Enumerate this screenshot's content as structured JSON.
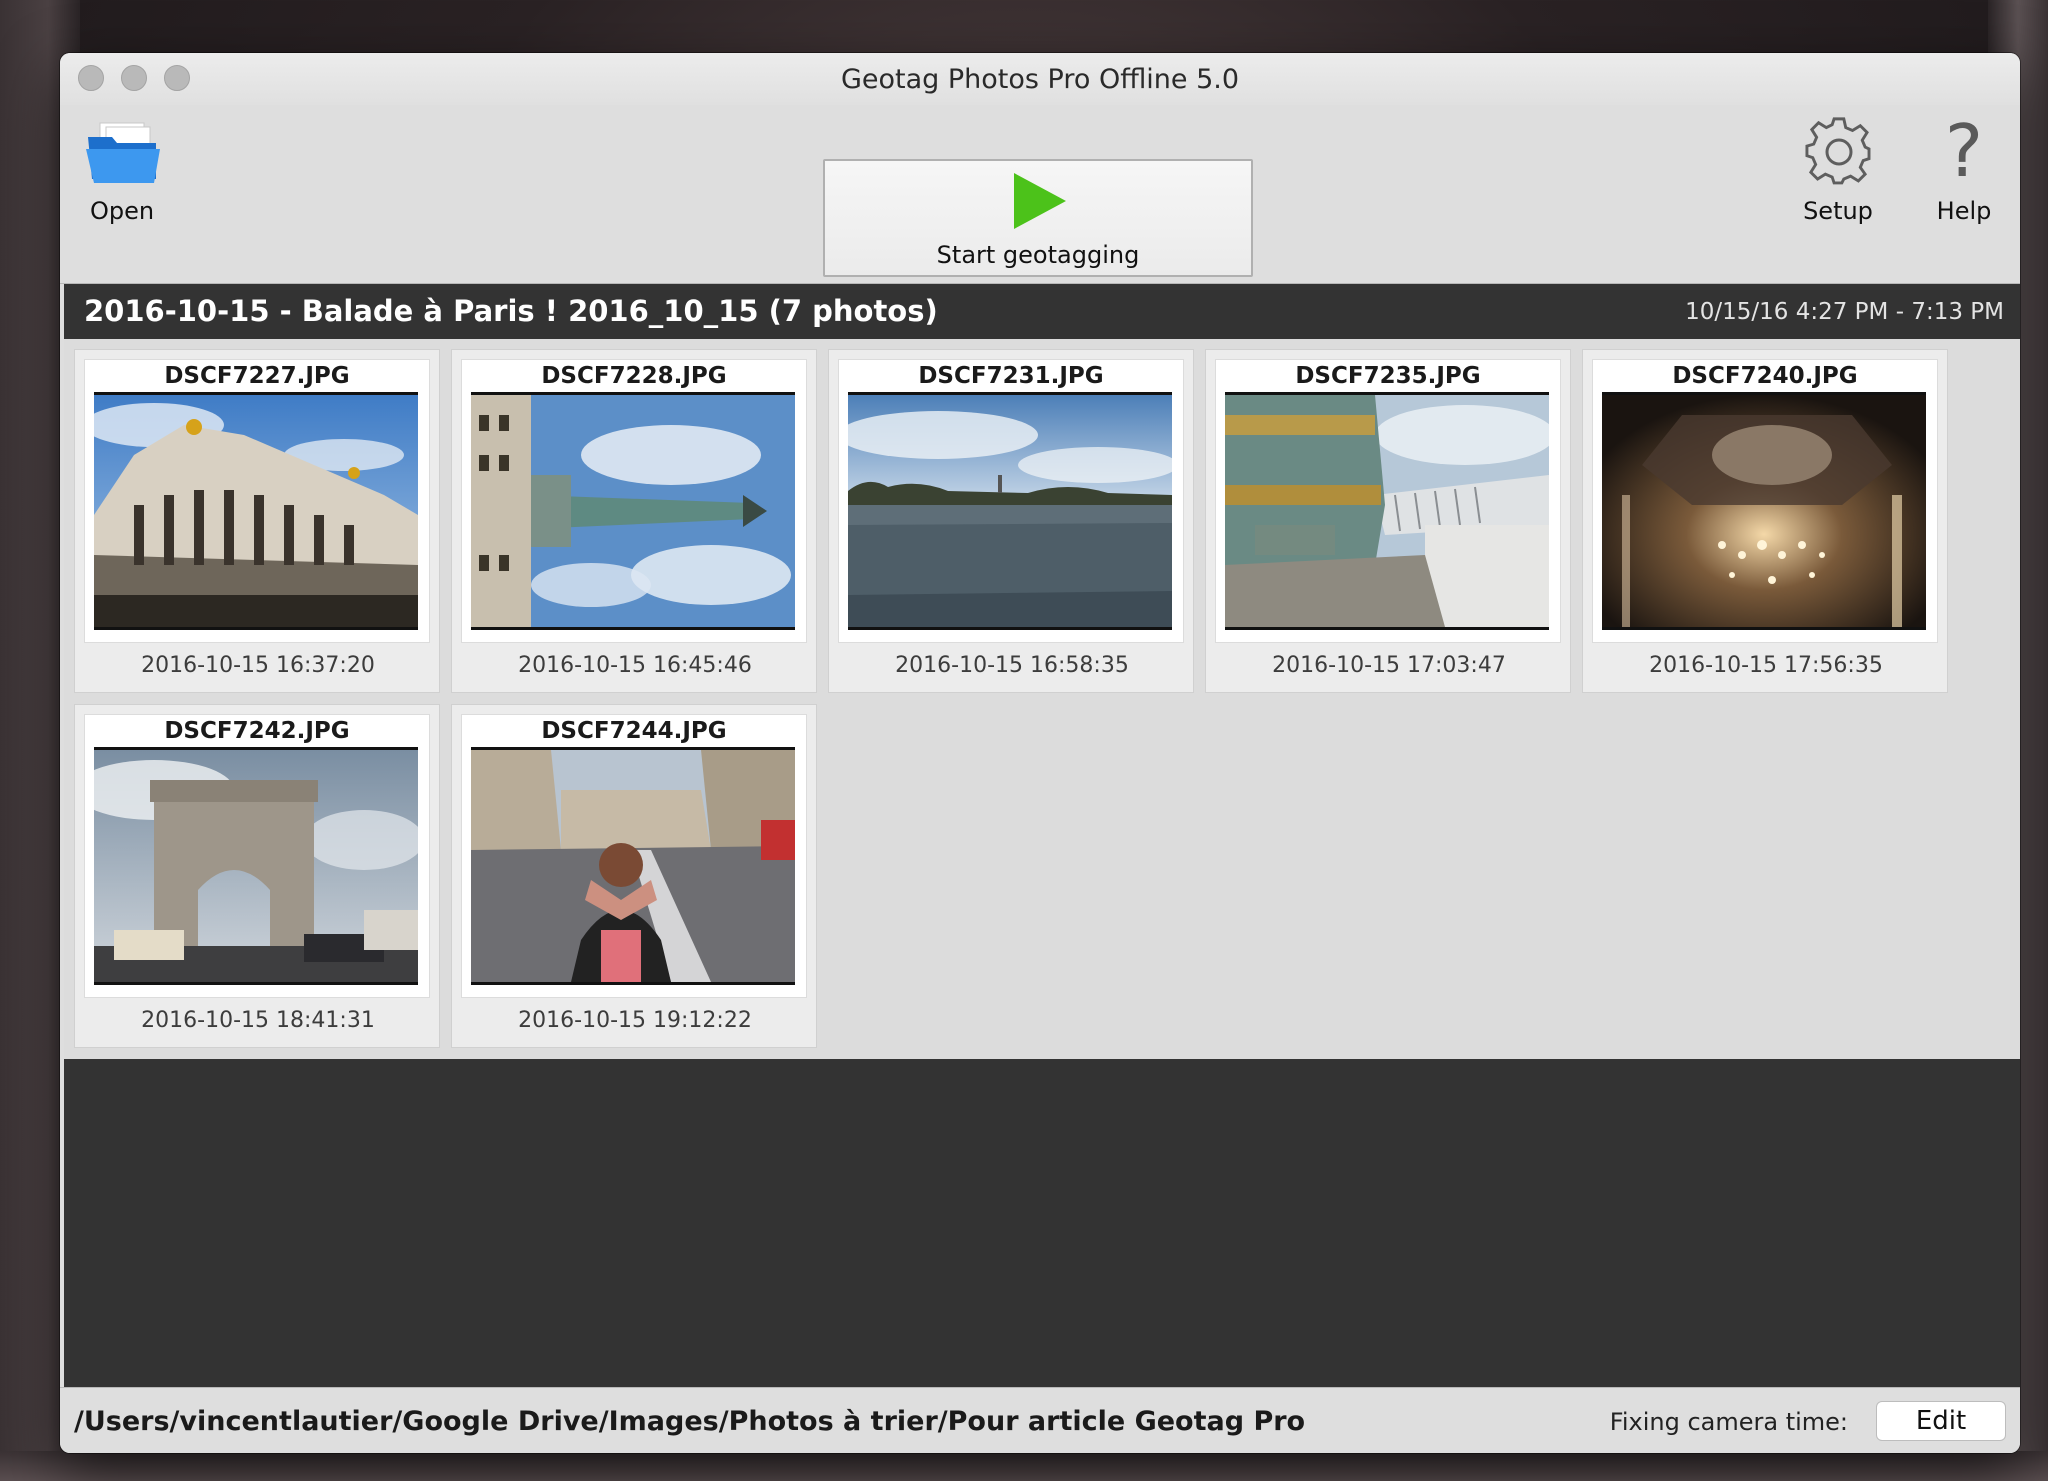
{
  "window": {
    "title": "Geotag Photos Pro Offline 5.0"
  },
  "toolbar": {
    "open_label": "Open",
    "start_label": "Start geotagging",
    "setup_label": "Setup",
    "help_label": "Help",
    "help_glyph": "?"
  },
  "album": {
    "title": "2016-10-15 - Balade à Paris ! 2016_10_15 (7 photos)",
    "time_range": "10/15/16 4:27 PM - 7:13 PM"
  },
  "photos": [
    {
      "filename": "DSCF7227.JPG",
      "datetime": "2016-10-15 16:37:20",
      "subject": "opera-building"
    },
    {
      "filename": "DSCF7228.JPG",
      "datetime": "2016-10-15 16:45:46",
      "subject": "vendome-column"
    },
    {
      "filename": "DSCF7231.JPG",
      "datetime": "2016-10-15 16:58:35",
      "subject": "fountain-pond"
    },
    {
      "filename": "DSCF7235.JPG",
      "datetime": "2016-10-15 17:03:47",
      "subject": "ornate-column-base"
    },
    {
      "filename": "DSCF7240.JPG",
      "datetime": "2016-10-15 17:56:35",
      "subject": "chandelier-interior"
    },
    {
      "filename": "DSCF7242.JPG",
      "datetime": "2016-10-15 18:41:31",
      "subject": "arc-de-triomphe"
    },
    {
      "filename": "DSCF7244.JPG",
      "datetime": "2016-10-15 19:12:22",
      "subject": "street-photographer"
    }
  ],
  "status": {
    "path": "/Users/vincentlautier/Google Drive/Images/Photos à trier/Pour article Geotag Pro",
    "fix_label": "Fixing camera time:",
    "edit_label": "Edit"
  },
  "icons": {
    "open": "folder-icon",
    "start": "play-icon",
    "setup": "gear-icon",
    "help": "question-icon"
  },
  "colors": {
    "play_green": "#4cc21a",
    "folder_blue": "#2f8ae0",
    "header_dark": "#333333"
  }
}
